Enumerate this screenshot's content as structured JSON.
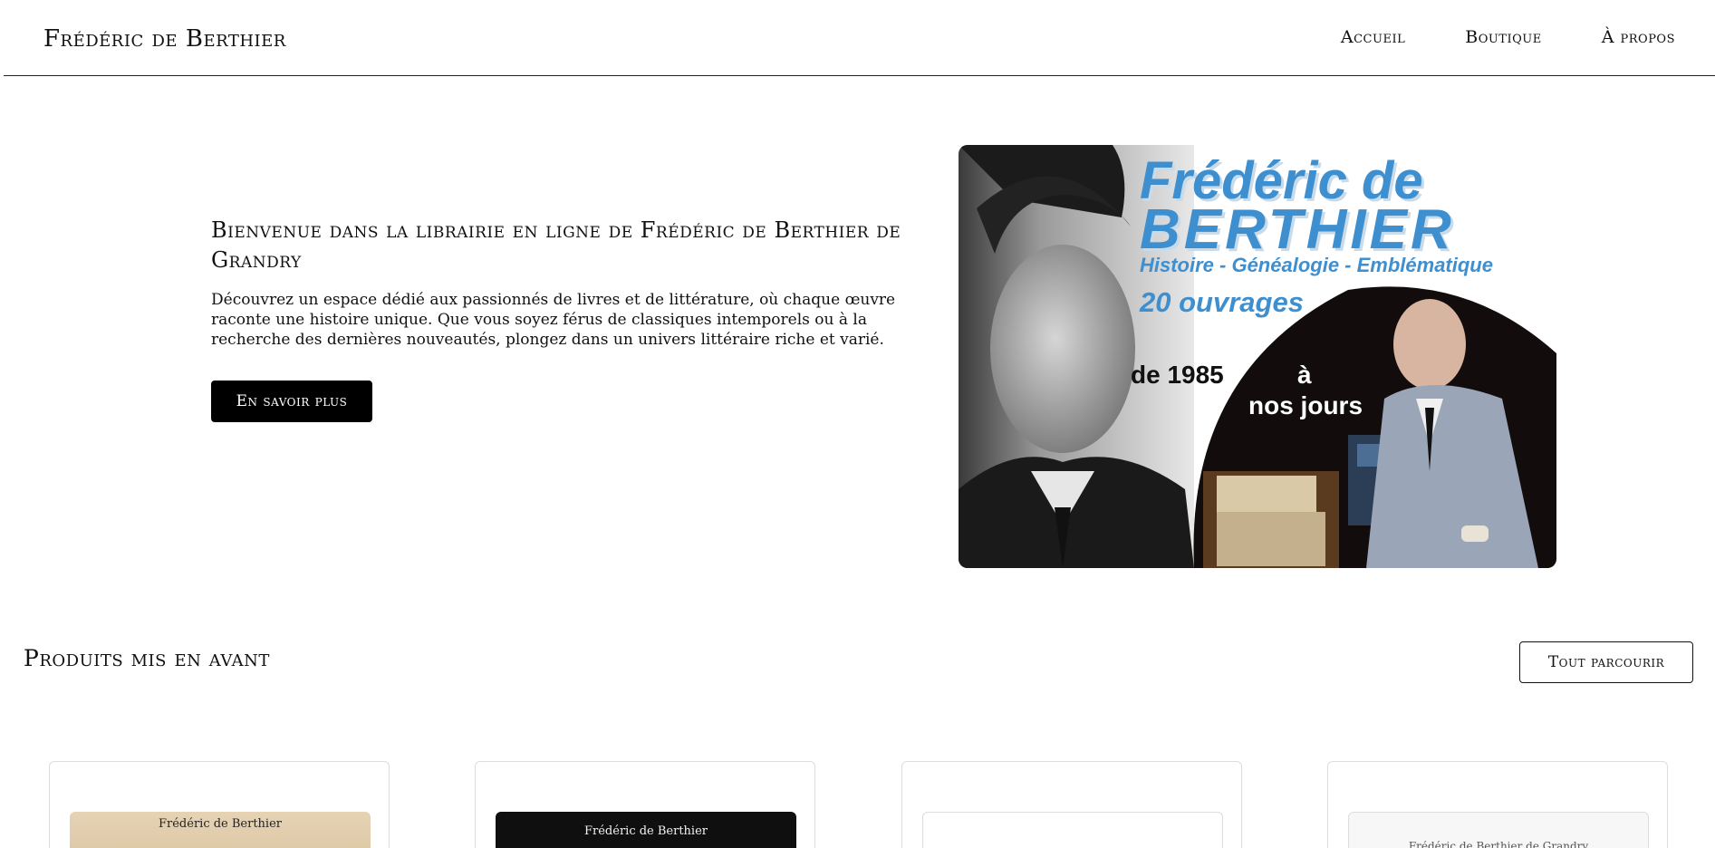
{
  "header": {
    "brand": "Frédéric de Berthier",
    "nav": [
      "Accueil",
      "Boutique",
      "À propos"
    ]
  },
  "hero": {
    "title": "Bienvenue dans la librairie en ligne de Frédéric de Berthier de Grandry",
    "description": "Découvrez un espace dédié aux passionnés de livres et de littérature, où chaque œuvre raconte une histoire unique. Que vous soyez férus de classiques intemporels ou à la recherche des dernières nouveautés, plongez dans un univers littéraire riche et varié.",
    "cta_label": "En savoir plus",
    "image": {
      "name_line1": "Frédéric de",
      "name_line2": "BERTHIER",
      "subtitle": "Histoire - Généalogie - Emblématique",
      "count": "20 ouvrages",
      "from": "de 1985",
      "to_line1": "à",
      "to_line2": "nos jours"
    }
  },
  "featured": {
    "title": "Produits mis en avant",
    "browse_label": "Tout parcourir",
    "products": [
      {
        "thumb_label": "Frédéric de Berthier"
      },
      {
        "thumb_label": "Frédéric de Berthier"
      },
      {
        "thumb_label": ""
      },
      {
        "thumb_label": "Frédéric de Berthier de Grandry"
      }
    ]
  },
  "colors": {
    "accent": "#000000",
    "hero_blue": "#3d8fd0"
  }
}
